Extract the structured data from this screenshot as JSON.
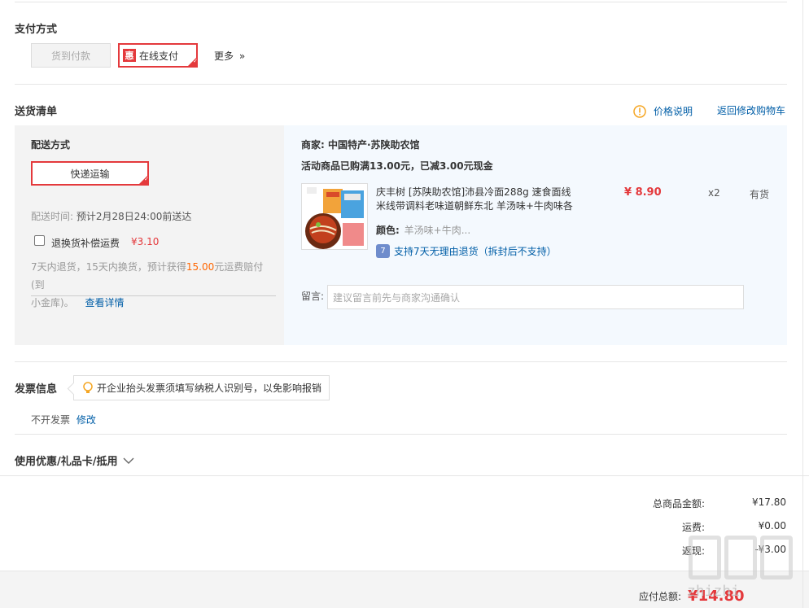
{
  "payment": {
    "title": "支付方式",
    "cod_label": "货到付款",
    "badge": "惠",
    "online_label": "在线支付",
    "more_label": "更多",
    "more_glyph": "»"
  },
  "delivery": {
    "title": "送货清单",
    "price_info_label": "价格说明",
    "back_to_cart_label": "返回修改购物车",
    "method_title": "配送方式",
    "method_label": "快递运输",
    "time_prefix": "配送时间:",
    "time_value": "预计2月28日24:00前送达",
    "insurance_label": "退换货补偿运费",
    "insurance_price": "¥3.10",
    "insurance_desc_1": "7天内退货，15天内换货，预计获得",
    "insurance_highlight": "15.00",
    "insurance_desc_2": "元运费赔付(到",
    "insurance_desc_3": "小金库)。",
    "detail_link": "查看详情"
  },
  "shop": {
    "prefix": "商家:",
    "name": "中国特产·苏陕助农馆",
    "promo": "活动商品已购满13.00元，已减3.00元现金",
    "product": {
      "title_line1": "庆丰树 [苏陕助农馆]沛县冷面288g 速食面线",
      "title_line2": "米线带调料老味道朝鲜东北 羊汤味+牛肉味各",
      "color_label": "颜色:",
      "color_value": "羊汤味+牛肉...",
      "return_badge": "7",
      "return_text": "支持7天无理由退货（拆封后不支持）",
      "price": "¥ 8.90",
      "qty": "x2",
      "stock": "有货"
    },
    "note_label": "留言:",
    "note_placeholder": "建议留言前先与商家沟通确认"
  },
  "invoice": {
    "title": "发票信息",
    "tip": "开企业抬头发票须填写纳税人识别号，以免影响报销",
    "value": "不开发票",
    "modify_label": "修改"
  },
  "coupon": {
    "title": "使用优惠/礼品卡/抵用"
  },
  "summary": {
    "goods_label": "总商品金额:",
    "goods_value": "¥17.80",
    "shipping_label": "运费:",
    "shipping_value": "¥0.00",
    "rebate_label": "返现:",
    "rebate_value": "-¥3.00",
    "total_label": "应付总额:",
    "total_value": "¥14.80"
  },
  "watermark": {
    "text": "zhizhi"
  },
  "colors": {
    "accent": "#e4393c",
    "link": "#005ea7",
    "highlight": "#ff6600"
  }
}
